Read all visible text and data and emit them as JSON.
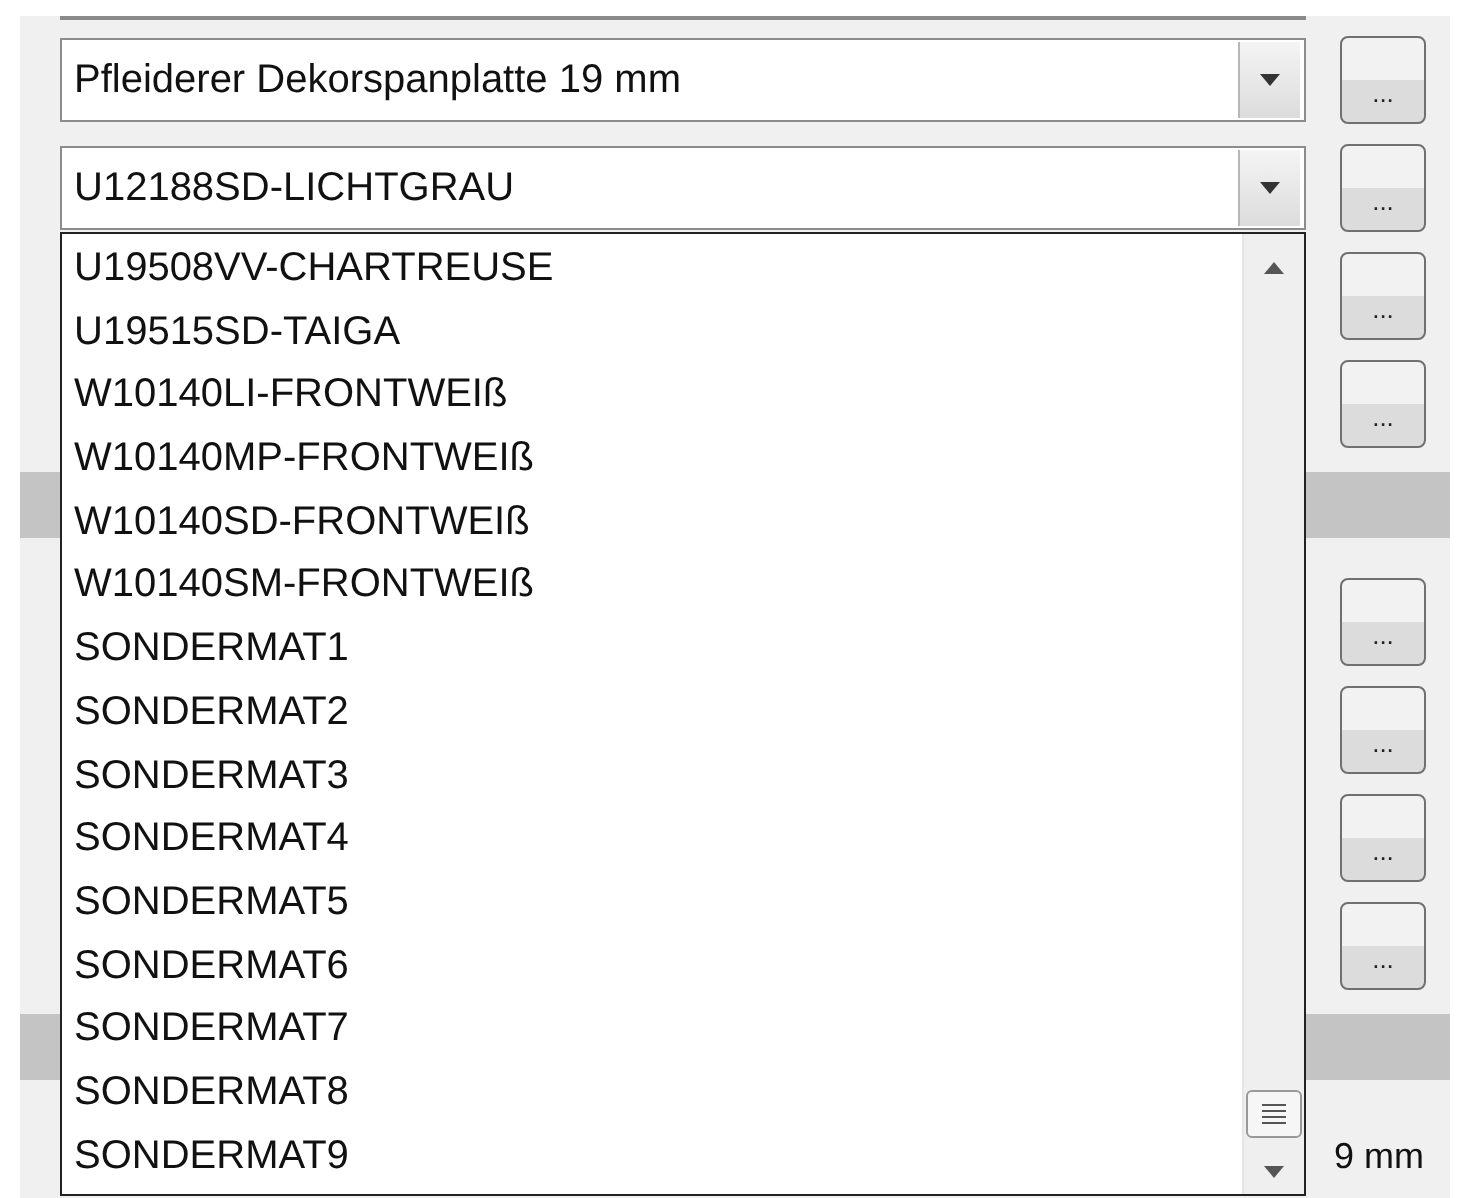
{
  "combos": [
    {
      "value": "Pfleiderer Dekorspanplatte 19 mm"
    },
    {
      "value": "U12188SD-LICHTGRAU"
    }
  ],
  "button_groups": [
    [
      "...",
      "...",
      "...",
      "..."
    ],
    [
      "...",
      "...",
      "...",
      "..."
    ]
  ],
  "dropdown": {
    "items": [
      {
        "label": "U19508VV-CHARTREUSE",
        "selected": false
      },
      {
        "label": "U19515SD-TAIGA",
        "selected": false
      },
      {
        "label": "W10140LI-FRONTWEIß",
        "selected": false
      },
      {
        "label": "W10140MP-FRONTWEIß",
        "selected": false
      },
      {
        "label": "W10140SD-FRONTWEIß",
        "selected": false
      },
      {
        "label": "W10140SM-FRONTWEIß",
        "selected": false
      },
      {
        "label": "SONDERMAT1",
        "selected": false
      },
      {
        "label": "SONDERMAT2",
        "selected": false
      },
      {
        "label": "SONDERMAT3",
        "selected": false
      },
      {
        "label": "SONDERMAT4",
        "selected": false
      },
      {
        "label": "SONDERMAT5",
        "selected": false
      },
      {
        "label": "SONDERMAT6",
        "selected": false
      },
      {
        "label": "SONDERMAT7",
        "selected": false
      },
      {
        "label": "SONDERMAT8",
        "selected": false
      },
      {
        "label": "SONDERMAT9",
        "selected": false
      }
    ]
  },
  "bottom_field": {
    "value": "9 mm"
  }
}
